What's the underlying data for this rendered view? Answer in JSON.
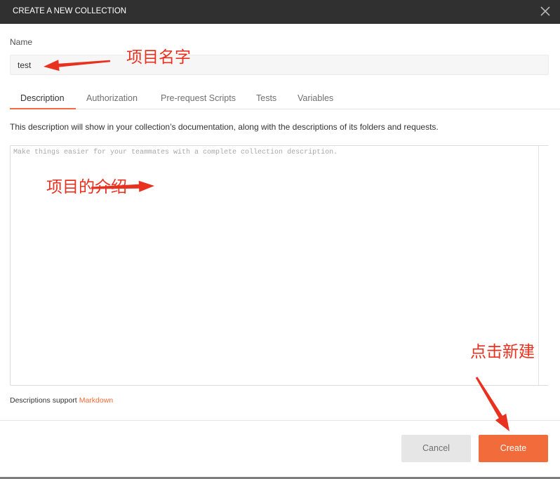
{
  "dialog": {
    "title": "CREATE A NEW COLLECTION",
    "close_icon": "close-icon"
  },
  "name_field": {
    "label": "Name",
    "value": "test"
  },
  "tabs": [
    {
      "label": "Description",
      "active": true
    },
    {
      "label": "Authorization",
      "active": false
    },
    {
      "label": "Pre-request Scripts",
      "active": false
    },
    {
      "label": "Tests",
      "active": false
    },
    {
      "label": "Variables",
      "active": false
    }
  ],
  "description": {
    "help_text": "This description will show in your collection’s documentation, along with the descriptions of its folders and requests.",
    "placeholder": "Make things easier for your teammates with a complete collection description."
  },
  "markdown_note": {
    "text": "Descriptions support",
    "link_label": "Markdown"
  },
  "footer": {
    "cancel_label": "Cancel",
    "create_label": "Create"
  },
  "annotations": {
    "name_note": "项目名字",
    "description_note": "项目的介绍",
    "create_note": "点击新建"
  },
  "colors": {
    "header_bg": "#303030",
    "accent": "#f26b3a",
    "annotation_red": "#e8311f",
    "cancel_bg": "#e6e6e6"
  }
}
